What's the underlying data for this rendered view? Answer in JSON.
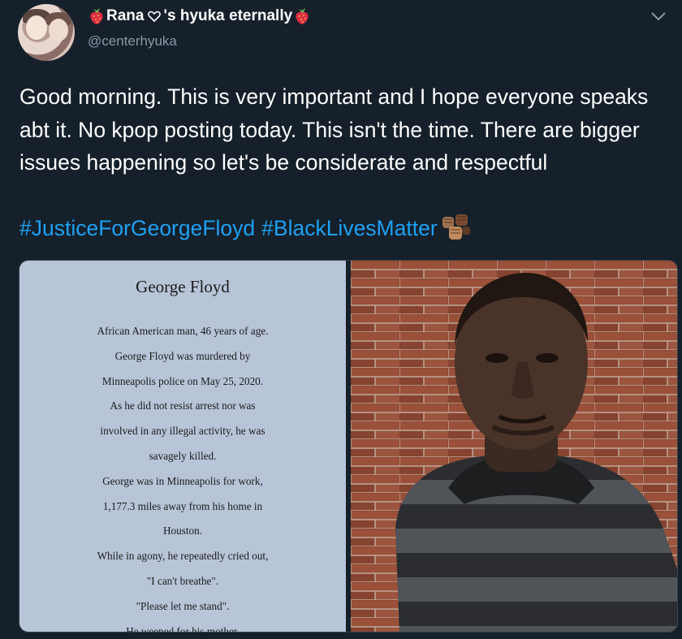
{
  "user": {
    "display_name": "Rana ♡'s hyuka eternally",
    "name_before_heart": "Rana",
    "name_after_heart": "'s hyuka eternally",
    "handle": "@centerhyuka"
  },
  "tweet": {
    "text": "Good morning. This is very important and I hope everyone speaks abt it. No kpop posting today. This isn't the time. There are bigger issues happening so let's be considerate and respectful",
    "hashtags": [
      "#JusticeForGeorgeFloyd",
      "#BlackLivesMatter"
    ]
  },
  "media": {
    "card_title": "George Floyd",
    "card_lines": [
      "African American man, 46 years of age.",
      "George Floyd was murdered by",
      "Minneapolis police on May 25, 2020.",
      "As he did not resist arrest nor was",
      "involved in any illegal activity, he was",
      "savagely killed.",
      "George was in Minneapolis for work,",
      "1,177.3 miles away from his home in",
      "Houston.",
      "While in agony, he repeatedly cried out,",
      "\"I can't breathe\".",
      "\"Please let me stand\".",
      "He weeped for his mother."
    ]
  },
  "icons": {
    "emoji_left": "strawberry-icon",
    "emoji_right": "strawberry-icon",
    "heart": "heart-outline-icon",
    "fists": "raised-fists-icon",
    "menu": "chevron-down-icon"
  },
  "colors": {
    "background": "#15202b",
    "text": "#ffffff",
    "secondary_text": "#8899a6",
    "hashtag": "#1da1f2",
    "card_background": "#b8c4d8"
  }
}
